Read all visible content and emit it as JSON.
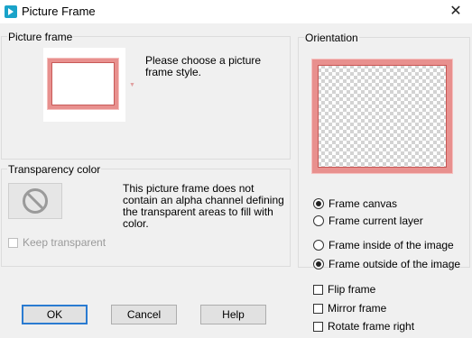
{
  "window": {
    "title": "Picture Frame",
    "close_glyph": "✕",
    "app_icon": "psp-icon"
  },
  "picture_frame": {
    "group_label": "Picture frame",
    "hint": "Please choose a picture frame style."
  },
  "transparency": {
    "group_label": "Transparency color",
    "message": "This picture frame does not contain an alpha channel defining the transparent areas to fill with color.",
    "keep_transparent_label": "Keep transparent",
    "keep_transparent_checked": false,
    "keep_transparent_enabled": false
  },
  "orientation": {
    "group_label": "Orientation",
    "frame_canvas": "Frame canvas",
    "frame_current_layer": "Frame current layer",
    "frame_inside": "Frame inside of the image",
    "frame_outside": "Frame outside of the image",
    "flip_frame": "Flip frame",
    "mirror_frame": "Mirror frame",
    "rotate_frame_right": "Rotate frame right",
    "selected_target": "Frame canvas",
    "selected_position": "Frame outside of the image"
  },
  "buttons": {
    "ok": "OK",
    "cancel": "Cancel",
    "help": "Help"
  },
  "colors": {
    "frame_pink": "#e8908e",
    "frame_dark_pink": "#c85a58",
    "focus_blue": "#2a7bd1"
  }
}
